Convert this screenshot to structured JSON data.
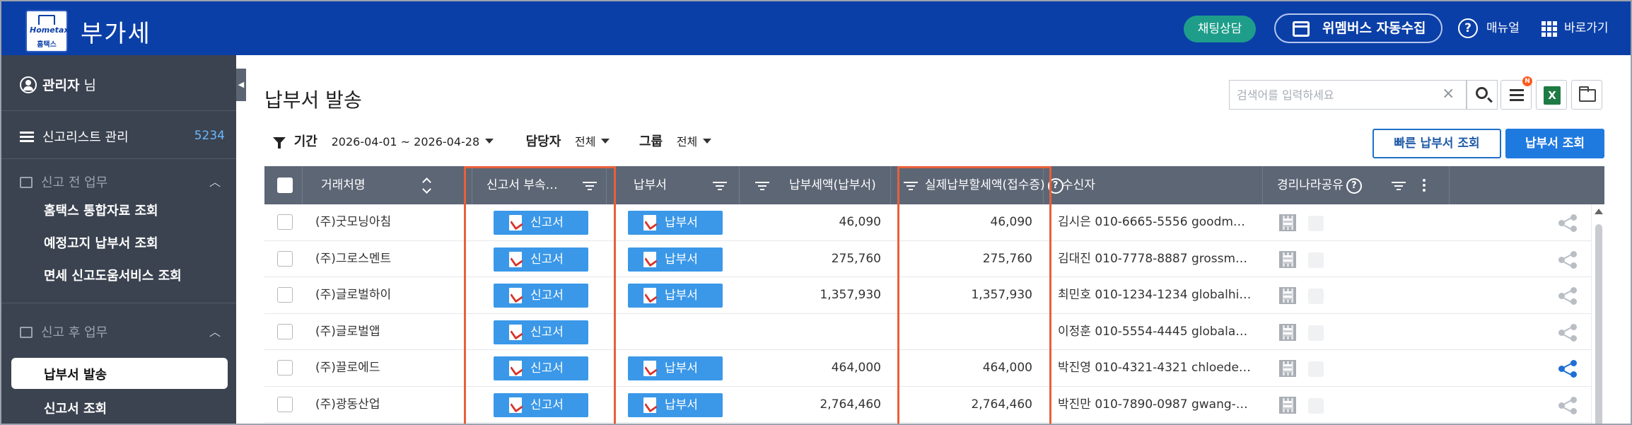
{
  "header": {
    "logo_top": "Hometax",
    "logo_bottom": "홈택스",
    "app_title": "부가세",
    "chat_label": "채팅상담",
    "collect_label": "위멤버스 자동수집",
    "help_label": "매뉴얼",
    "shortcut_label": "바로가기",
    "accent_color": "#0b3fa8"
  },
  "sidebar": {
    "user_name": "관리자",
    "user_suffix": " 님",
    "list_label": "신고리스트 관리",
    "list_count": "5234",
    "sections": [
      {
        "title": "신고 전 업무",
        "items": [
          "홈택스 통합자료 조회",
          "예정고지 납부서 조회",
          "면세 신고도움서비스 조회"
        ]
      },
      {
        "title": "신고 후 업무",
        "items": [
          "납부서 발송",
          "신고서 조회"
        ]
      }
    ],
    "active_item": "납부서 발송"
  },
  "main": {
    "page_title": "납부서 발송",
    "search_placeholder": "검색어를 입력하세요",
    "new_badge": "N",
    "excel_label": "X",
    "filters": {
      "period_label": "기간",
      "period_value": "2026-04-01 ~ 2026-04-28",
      "manager_label": "담당자",
      "manager_value": "전체",
      "group_label": "그룹",
      "group_value": "전체"
    },
    "quick_button": "빠른 납부서 조회",
    "search_button": "납부서 조회"
  },
  "table": {
    "columns": {
      "client": "거래처명",
      "attachment": "신고서 부속…",
      "bill": "납부서",
      "tax_amount": "납부세액(납부서)",
      "actual_amount": "실제납부할세액(접수증)",
      "recipient": "수신자",
      "share": "경리나라공유"
    },
    "help_glyph": "?",
    "report_btn": "신고서",
    "bill_btn": "납부서",
    "rows": [
      {
        "client": "(주)굿모닝아침",
        "has_bill": true,
        "tax": "46,090",
        "actual": "46,090",
        "recipient": "김시은 010-6665-5556 goodm…",
        "shared": false
      },
      {
        "client": "(주)그로스멘트",
        "has_bill": true,
        "tax": "275,760",
        "actual": "275,760",
        "recipient": "김대진 010-7778-8887 grossm…",
        "shared": false
      },
      {
        "client": "(주)글로벌하이",
        "has_bill": true,
        "tax": "1,357,930",
        "actual": "1,357,930",
        "recipient": "최민호 010-1234-1234 globalhi…",
        "shared": false
      },
      {
        "client": "(주)글로벌앱",
        "has_bill": false,
        "tax": "",
        "actual": "",
        "recipient": "이정훈 010-5554-4445 globala…",
        "shared": false
      },
      {
        "client": "(주)끌로에드",
        "has_bill": true,
        "tax": "464,000",
        "actual": "464,000",
        "recipient": "박진영 010-4321-4321 chloede…",
        "shared": true
      },
      {
        "client": "(주)광동산업",
        "has_bill": true,
        "tax": "2,764,460",
        "actual": "2,764,460",
        "recipient": "박진만 010-7890-0987 gwang-…",
        "shared": false
      }
    ],
    "highlight_color": "#e8603a",
    "share_active_color": "#1f6fd6",
    "share_inactive_color": "#b9bec5"
  }
}
